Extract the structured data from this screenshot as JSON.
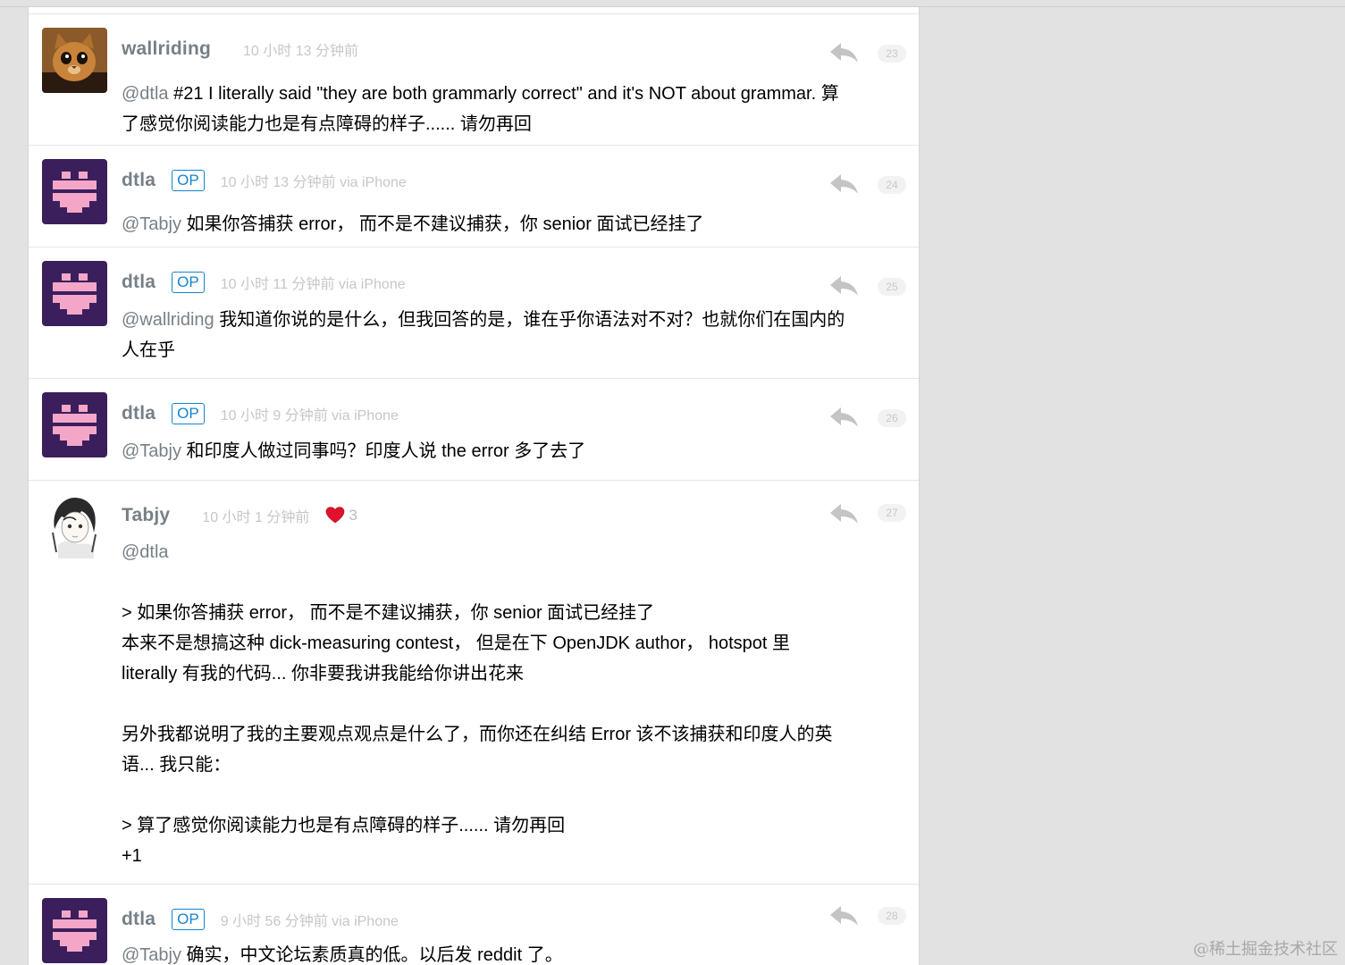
{
  "colors": {
    "page_bg": "#e2e2e2",
    "card_bg": "#ffffff",
    "username": "#778087",
    "op_badge": "#1484cd",
    "time": "#c7c7c7",
    "heart": "#e0112c"
  },
  "replies": [
    {
      "username": "wallriding",
      "op": false,
      "time": "10 小时 13 分钟前",
      "floor": "23",
      "avatar": "cat-avatar",
      "mention": "@dtla",
      "lines": [
        " #21 I literally said \"they are both grammarly correct\" and it's NOT about grammar. 算",
        "了感觉你阅读能力也是有点障碍的样子...... 请勿再回"
      ]
    },
    {
      "username": "dtla",
      "op": true,
      "op_label": "OP",
      "time": "10 小时 13 分钟前 via iPhone",
      "floor": "24",
      "avatar": "pixel-avatar",
      "mention": "@Tabjy",
      "lines": [
        " 如果你答捕获 error， 而不是不建议捕获，你 senior 面试已经挂了"
      ]
    },
    {
      "username": "dtla",
      "op": true,
      "op_label": "OP",
      "time": "10 小时 11 分钟前 via iPhone",
      "floor": "25",
      "avatar": "pixel-avatar",
      "mention": "@wallriding",
      "lines": [
        " 我知道你说的是什么，但我回答的是，谁在乎你语法对不对？也就你们在国内的",
        "人在乎"
      ]
    },
    {
      "username": "dtla",
      "op": true,
      "op_label": "OP",
      "time": "10 小时 9 分钟前 via iPhone",
      "floor": "26",
      "avatar": "pixel-avatar",
      "mention": "@Tabjy",
      "lines": [
        " 和印度人做过同事吗？印度人说 the error 多了去了"
      ]
    },
    {
      "username": "Tabjy",
      "op": false,
      "time": "10 小时 1 分钟前",
      "likes": "3",
      "floor": "27",
      "avatar": "sketch-avatar",
      "mention": "@dtla",
      "body": [
        "> 如果你答捕获 error， 而不是不建议捕获，你 senior 面试已经挂了",
        "本来不是想搞这种 dick-measuring contest， 但是在下 OpenJDK author， hotspot 里",
        "literally 有我的代码... 你非要我讲我能给你讲出花来",
        "",
        "另外我都说明了我的主要观点观点是什么了，而你还在纠结 Error 该不该捕获和印度人的英",
        "语... 我只能：",
        "",
        "> 算了感觉你阅读能力也是有点障碍的样子...... 请勿再回",
        "+1"
      ]
    },
    {
      "username": "dtla",
      "op": true,
      "op_label": "OP",
      "time": "9 小时 56 分钟前 via iPhone",
      "floor": "28",
      "avatar": "pixel-avatar",
      "mention": "@Tabjy",
      "lines": [
        " 确实，中文论坛素质真的低。以后发 reddit 了。"
      ]
    }
  ],
  "watermark": "@稀土掘金技术社区"
}
